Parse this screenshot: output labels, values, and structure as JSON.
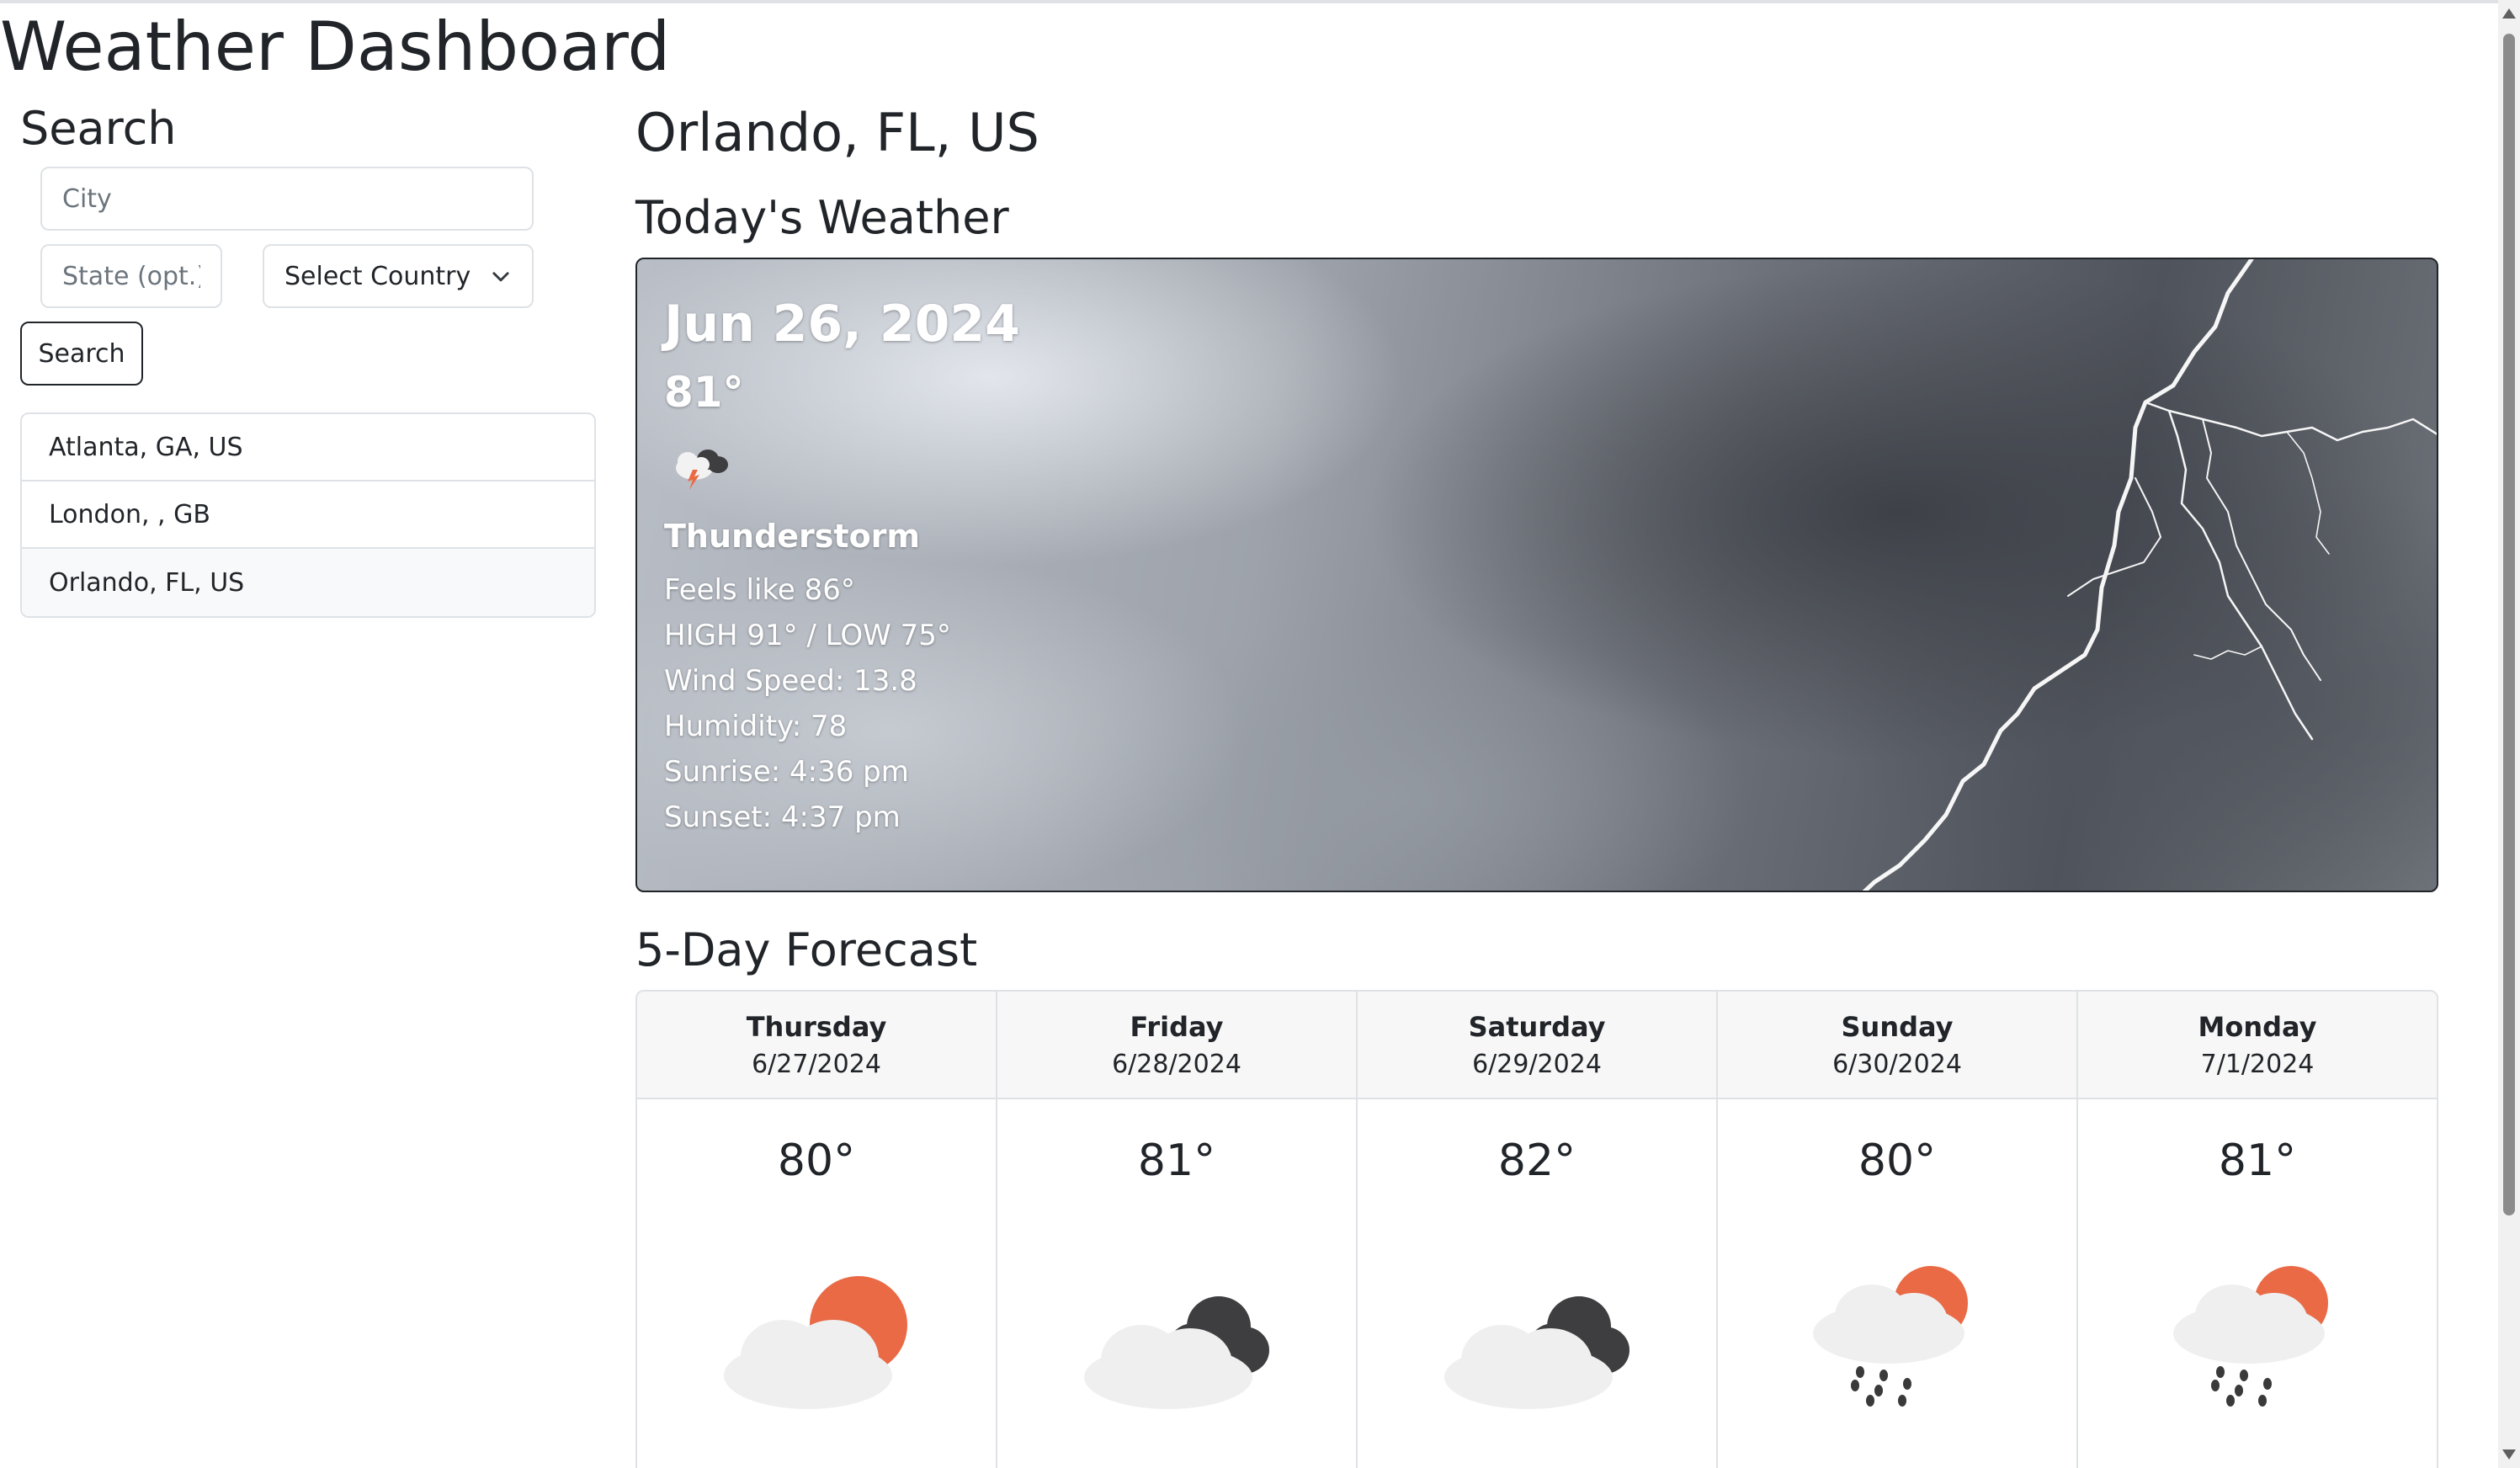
{
  "app": {
    "title": "Weather Dashboard"
  },
  "sidebar": {
    "title": "Search",
    "city_placeholder": "City",
    "state_placeholder": "State (opt.)",
    "country_select_value": "Select Country",
    "search_button": "Search",
    "history": [
      {
        "label": "Atlanta, GA, US"
      },
      {
        "label": "London, , GB"
      },
      {
        "label": "Orlando, FL, US"
      }
    ]
  },
  "main": {
    "location": "Orlando, FL, US",
    "today_heading": "Today's Weather",
    "today": {
      "date": "Jun 26, 2024",
      "temp": "81°",
      "icon": "thunderstorm-icon",
      "condition": "Thunderstorm",
      "feels_like": "Feels like 86°",
      "high_low": "HIGH 91° / LOW 75°",
      "wind": "Wind Speed: 13.8",
      "humidity": "Humidity: 78",
      "sunrise": "Sunrise: 4:36 pm",
      "sunset": "Sunset: 4:37 pm"
    },
    "forecast_heading": "5-Day Forecast",
    "forecast": [
      {
        "day": "Thursday",
        "date": "6/27/2024",
        "temp": "80°",
        "icon": "partly-sunny-cloud-icon"
      },
      {
        "day": "Friday",
        "date": "6/28/2024",
        "temp": "81°",
        "icon": "dark-clouds-icon"
      },
      {
        "day": "Saturday",
        "date": "6/29/2024",
        "temp": "82°",
        "icon": "dark-clouds-icon"
      },
      {
        "day": "Sunday",
        "date": "6/30/2024",
        "temp": "80°",
        "icon": "sun-rain-cloud-icon"
      },
      {
        "day": "Monday",
        "date": "7/1/2024",
        "temp": "81°",
        "icon": "sun-rain-cloud-icon"
      }
    ]
  },
  "colors": {
    "sun": "#e96a45",
    "cloud_light": "#ededed",
    "cloud_dark": "#3e3e40",
    "rain": "#3a3a3a"
  }
}
